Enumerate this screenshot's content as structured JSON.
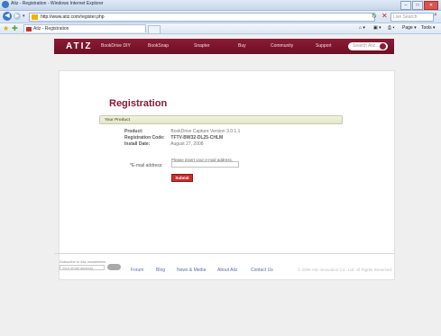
{
  "window": {
    "title": "Atiz - Registration - Windows Internet Explorer"
  },
  "browser": {
    "url": "http://www.atiz.com/register.php",
    "search_placeholder": "Live Search",
    "tab_title": "Atiz - Registration",
    "commands": {
      "page": "Page ▾",
      "tools": "Tools ▾"
    }
  },
  "site": {
    "logo": "ATIZ",
    "nav": [
      "BookDrive DIY",
      "BookSnap",
      "Snapter",
      "Buy",
      "Community",
      "Support"
    ],
    "search_placeholder": "Search Atiz..."
  },
  "registration": {
    "title": "Registration",
    "section": "Your Product",
    "rows": [
      {
        "label": "Product:",
        "value": "BookDrive Capture Version 3.0.1.1"
      },
      {
        "label": "Registration Code:",
        "value": "TFTV-BW32-DL25-CHLM"
      },
      {
        "label": "Install Date:",
        "value": "August 27, 2008"
      }
    ],
    "hint": "Please insert your e-mail address.",
    "email_label": "*E-mail address:",
    "email_value": "",
    "submit": "Submit"
  },
  "footer": {
    "newsletter_label": "Subscribe to Atiz newsletters",
    "newsletter_placeholder": "Your email address",
    "links": [
      "Forum",
      "Blog",
      "News & Media",
      "About Atiz",
      "Contact Us"
    ],
    "copyright": "© 2008 Atiz Innovation Co., Ltd. All Rights Reserved."
  }
}
